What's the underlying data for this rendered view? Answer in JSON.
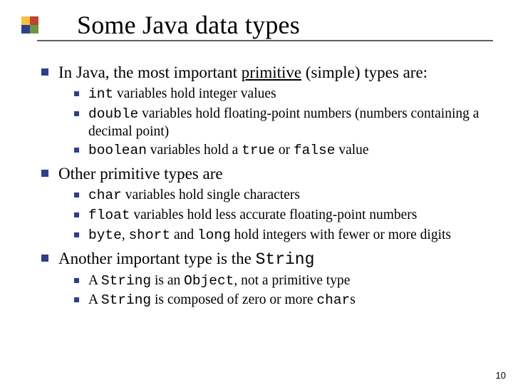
{
  "accent_colors": {
    "yellow": "#f6c244",
    "red": "#c1432e",
    "blue": "#2e3e8e",
    "green": "#6a9a3d"
  },
  "title": "Some Java data types",
  "page_number": "10",
  "p1": {
    "lead": "In Java, the most important ",
    "underlined": "primitive",
    "tail": " (simple) types are:",
    "items": [
      {
        "code": "int",
        "text": " variables hold integer values"
      },
      {
        "code": "double",
        "text": " variables hold floating-point numbers (numbers containing a decimal point)"
      },
      {
        "code1": "boolean",
        "mid1": " variables hold a ",
        "code2": "true",
        "mid2": " or ",
        "code3": "false",
        "tail": " value"
      }
    ]
  },
  "p2": {
    "text": "Other primitive types are",
    "items": [
      {
        "code": "char",
        "text": " variables hold single characters"
      },
      {
        "code": "float",
        "text": " variables hold less accurate floating-point numbers"
      },
      {
        "code1": "byte",
        "mid1": ", ",
        "code2": "short",
        "mid2": " and ",
        "code3": "long",
        "tail": " hold integers with fewer or more digits"
      }
    ]
  },
  "p3": {
    "lead": "Another important type is the ",
    "code": "String",
    "items": [
      {
        "pre": "A ",
        "code1": "String",
        "mid1": " is an ",
        "code2": "Object",
        "tail": ", not a primitive type"
      },
      {
        "pre": "A ",
        "code1": "String",
        "mid1": " is composed of zero or more ",
        "code2": "char",
        "tail": "s"
      }
    ]
  }
}
